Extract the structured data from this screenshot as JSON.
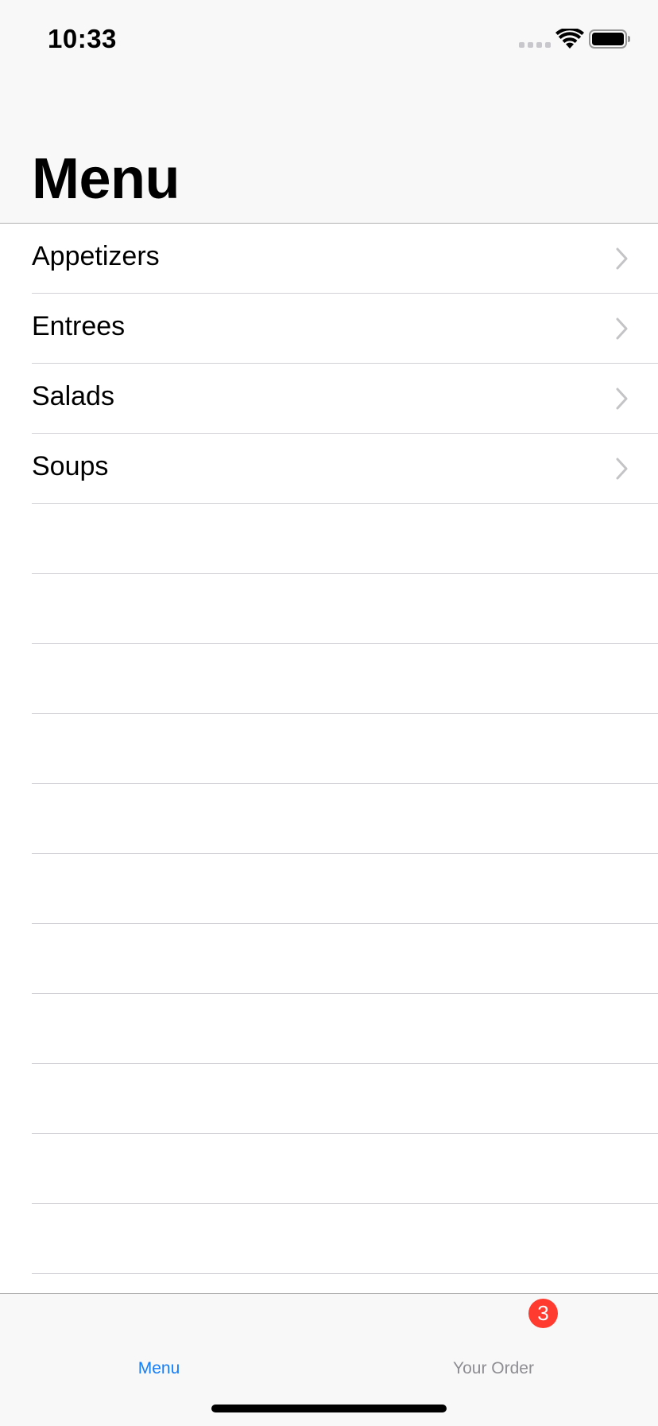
{
  "status_bar": {
    "time": "10:33"
  },
  "header": {
    "title": "Menu"
  },
  "menu": {
    "items": [
      {
        "label": "Appetizers",
        "icon": "chevron-right-icon"
      },
      {
        "label": "Entrees",
        "icon": "chevron-right-icon"
      },
      {
        "label": "Salads",
        "icon": "chevron-right-icon"
      },
      {
        "label": "Soups",
        "icon": "chevron-right-icon"
      }
    ]
  },
  "tab_bar": {
    "tabs": [
      {
        "label": "Menu",
        "selected": true
      },
      {
        "label": "Your Order",
        "selected": false,
        "badge": "3"
      }
    ]
  },
  "colors": {
    "accent": "#147efb",
    "badge": "#ff3b30",
    "inactive_tab": "#8e8e93"
  }
}
